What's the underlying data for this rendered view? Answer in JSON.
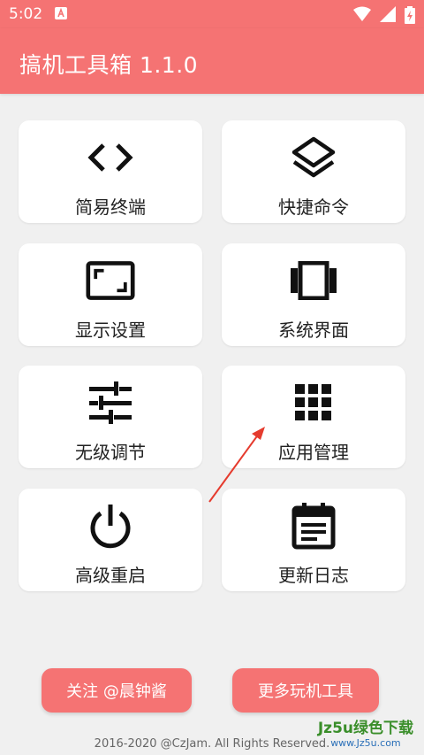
{
  "status_bar": {
    "time": "5:02",
    "icons": [
      "notification-a-icon",
      "wifi-icon",
      "signal-icon",
      "battery-charging-icon"
    ]
  },
  "app_bar": {
    "title": "搞机工具箱 1.1.0"
  },
  "colors": {
    "accent": "#f57373",
    "background": "#f0f0f0",
    "card": "#ffffff"
  },
  "grid": [
    {
      "label": "简易终端",
      "icon": "code-brackets-icon"
    },
    {
      "label": "快捷命令",
      "icon": "layers-icon"
    },
    {
      "label": "显示设置",
      "icon": "aspect-ratio-icon"
    },
    {
      "label": "系统界面",
      "icon": "view-carousel-icon"
    },
    {
      "label": "无级调节",
      "icon": "sliders-icon"
    },
    {
      "label": "应用管理",
      "icon": "apps-grid-icon"
    },
    {
      "label": "高级重启",
      "icon": "power-icon"
    },
    {
      "label": "更新日志",
      "icon": "calendar-notes-icon"
    }
  ],
  "buttons": {
    "follow": "关注 @晨钟酱",
    "more": "更多玩机工具"
  },
  "footer": "2016-2020 @CzJam. All Rights Reserved.",
  "watermark": {
    "main": "Jz5u绿色下载",
    "sub": "www.Jz5u.com"
  }
}
